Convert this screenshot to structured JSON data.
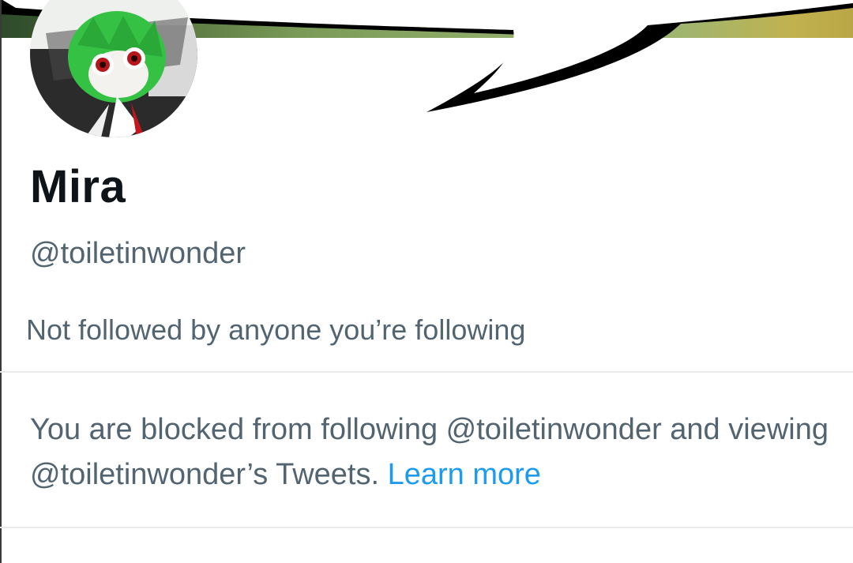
{
  "profile": {
    "display_name": "Mira",
    "handle": "@toiletinwonder",
    "followed_by_text": "Not followed by anyone you’re following"
  },
  "blocked_notice": {
    "text": "You are blocked from following @toiletinwonder and viewing @toiletinwonder’s Tweets.",
    "learn_more_label": "Learn more"
  },
  "colors": {
    "primary_text": "#0f1419",
    "secondary_text": "#536471",
    "link": "#1d9bf0",
    "divider": "#e7e9ea"
  }
}
